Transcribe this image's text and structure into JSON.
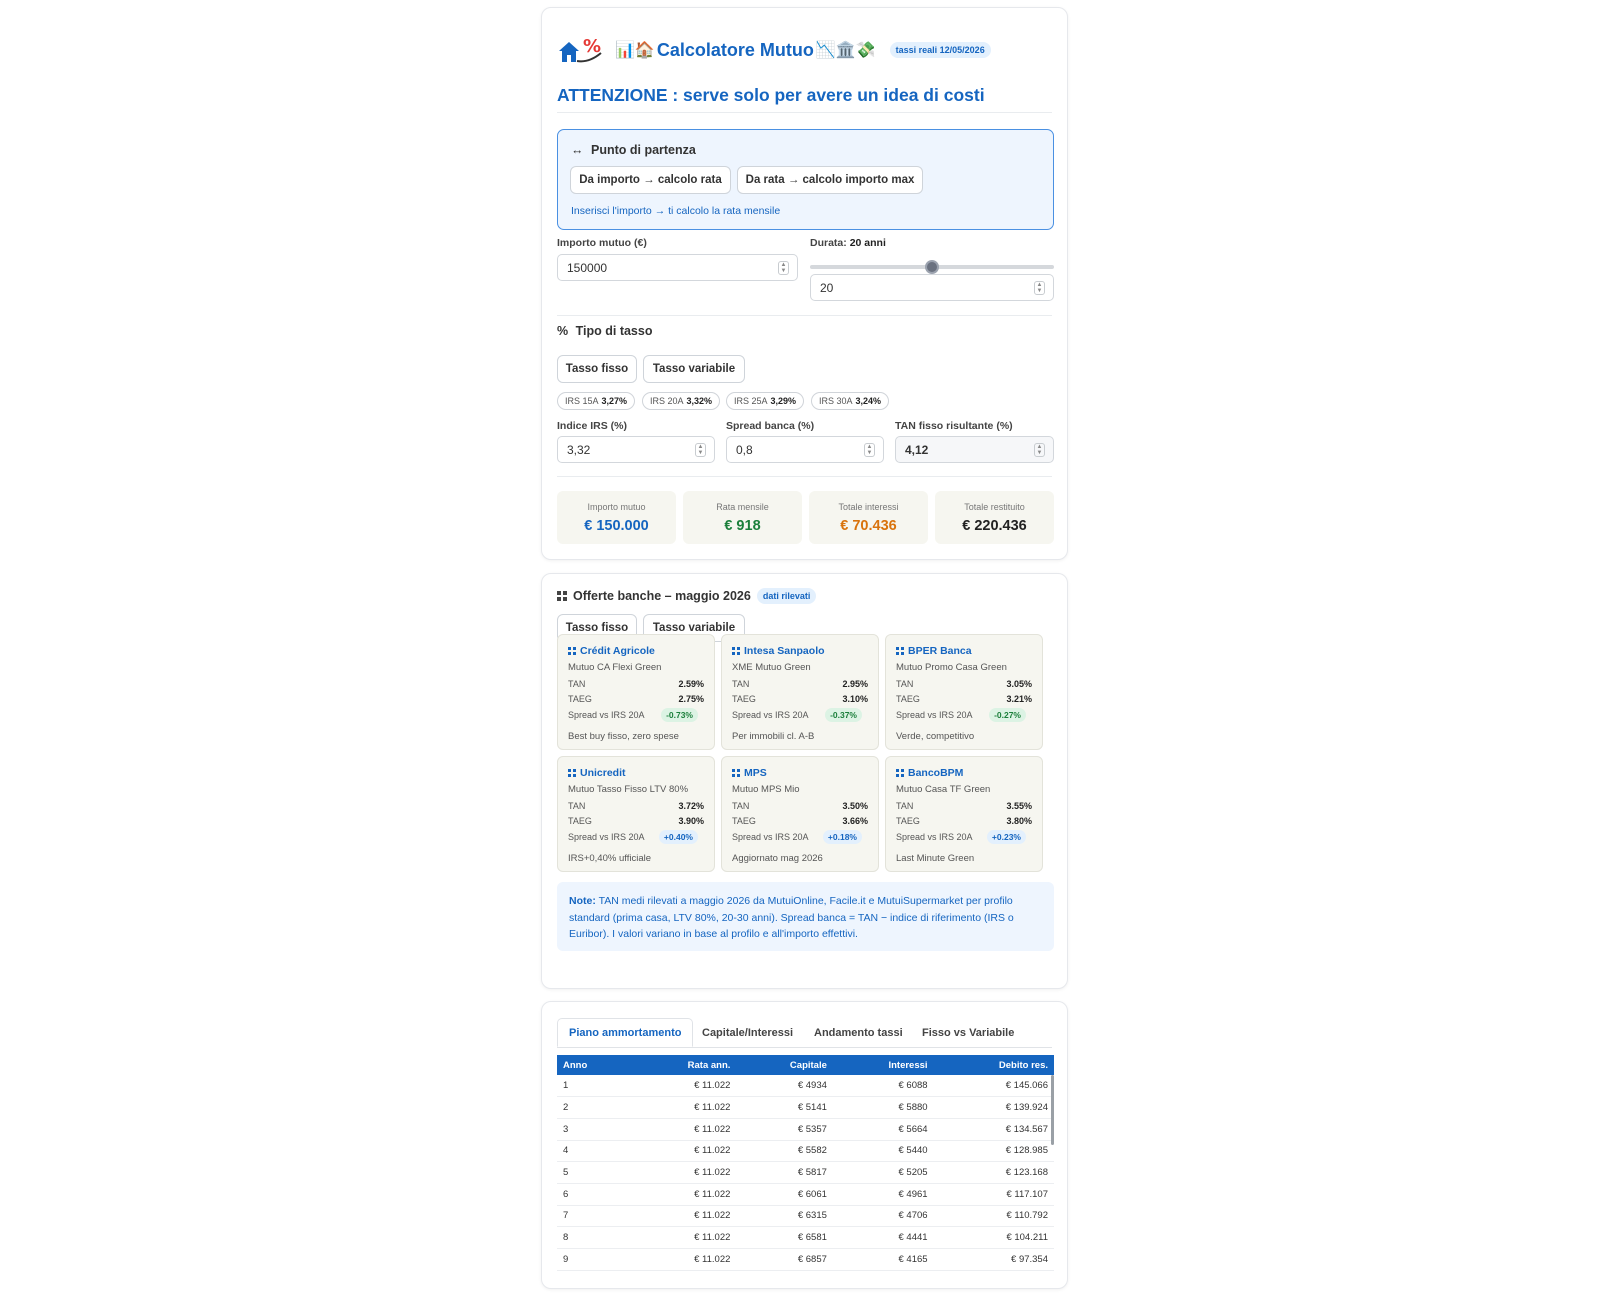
{
  "header": {
    "title_prefix_emoji": "📊🏠",
    "title": "Calcolatore Mutuo",
    "title_suffix_emoji": "📉🏛️💸",
    "rates_badge": "tassi reali 12/05/2026",
    "warning": "ATTENZIONE : serve solo per avere un idea di costi"
  },
  "start": {
    "icon": "↔",
    "title": "Punto di partenza",
    "btn_amount": "Da importo → calcolo rata",
    "btn_rate": "Da rata → calcolo importo max",
    "hint": "Inserisci l'importo → ti calcolo la rata mensile"
  },
  "amount": {
    "label": "Importo mutuo (€)",
    "value": "150000"
  },
  "duration": {
    "label": "Durata:",
    "label_value": "20 anni",
    "value": "20",
    "slider_fraction": 0.5
  },
  "rate_type": {
    "icon": "%",
    "title": "Tipo di tasso",
    "tab_fixed": "Tasso fisso",
    "tab_variable": "Tasso variabile",
    "chips": [
      {
        "label": "IRS 15A",
        "value": "3,27%"
      },
      {
        "label": "IRS 20A",
        "value": "3,32%"
      },
      {
        "label": "IRS 25A",
        "value": "3,29%"
      },
      {
        "label": "IRS 30A",
        "value": "3,24%"
      }
    ],
    "irs_label": "Indice IRS (%)",
    "irs_value": "3,32",
    "spread_label": "Spread banca (%)",
    "spread_value": "0,8",
    "tan_label": "TAN fisso risultante (%)",
    "tan_value": "4,12"
  },
  "summary": [
    {
      "label": "Importo mutuo",
      "value": "€ 150.000",
      "color": "#1565c0"
    },
    {
      "label": "Rata mensile",
      "value": "€ 918",
      "color": "#1b7f3b"
    },
    {
      "label": "Totale interessi",
      "value": "€ 70.436",
      "color": "#d9730d"
    },
    {
      "label": "Totale restituito",
      "value": "€ 220.436",
      "color": "#222222"
    }
  ],
  "offers": {
    "title": "Offerte banche – maggio 2026",
    "badge": "dati rilevati",
    "tab_fixed": "Tasso fisso",
    "tab_variable": "Tasso variabile",
    "tan_label": "TAN",
    "taeg_label": "TAEG",
    "spread_label": "Spread vs IRS 20A",
    "banks": [
      {
        "name": "Crédit Agricole",
        "product": "Mutuo CA Flexi Green",
        "tan": "2.59%",
        "taeg": "2.75%",
        "spread": "-0.73%",
        "sign": "neg",
        "note": "Best buy fisso, zero spese"
      },
      {
        "name": "Intesa Sanpaolo",
        "product": "XME Mutuo Green",
        "tan": "2.95%",
        "taeg": "3.10%",
        "spread": "-0.37%",
        "sign": "neg",
        "note": "Per immobili cl. A-B"
      },
      {
        "name": "BPER Banca",
        "product": "Mutuo Promo Casa Green",
        "tan": "3.05%",
        "taeg": "3.21%",
        "spread": "-0.27%",
        "sign": "neg",
        "note": "Verde, competitivo"
      },
      {
        "name": "Unicredit",
        "product": "Mutuo Tasso Fisso LTV 80%",
        "tan": "3.72%",
        "taeg": "3.90%",
        "spread": "+0.40%",
        "sign": "pos",
        "note": "IRS+0,40% ufficiale"
      },
      {
        "name": "MPS",
        "product": "Mutuo MPS Mio",
        "tan": "3.50%",
        "taeg": "3.66%",
        "spread": "+0.18%",
        "sign": "pos",
        "note": "Aggiornato mag 2026"
      },
      {
        "name": "BancoBPM",
        "product": "Mutuo Casa TF Green",
        "tan": "3.55%",
        "taeg": "3.80%",
        "spread": "+0.23%",
        "sign": "pos",
        "note": "Last Minute Green"
      }
    ],
    "note_label": "Note:",
    "note_text": "TAN medi rilevati a maggio 2026 da MutuiOnline, Facile.it e MutuiSupermarket per profilo standard (prima casa, LTV 80%, 20-30 anni). Spread banca = TAN − indice di riferimento (IRS o Euribor). I valori variano in base al profilo e all'importo effettivi."
  },
  "plan": {
    "tabs": [
      "Piano ammortamento",
      "Capitale/Interessi",
      "Andamento tassi",
      "Fisso vs Variabile"
    ],
    "columns": [
      "Anno",
      "Rata ann.",
      "Capitale",
      "Interessi",
      "Debito res."
    ],
    "rows": [
      [
        "1",
        "€ 11.022",
        "€ 4934",
        "€ 6088",
        "€ 145.066"
      ],
      [
        "2",
        "€ 11.022",
        "€ 5141",
        "€ 5880",
        "€ 139.924"
      ],
      [
        "3",
        "€ 11.022",
        "€ 5357",
        "€ 5664",
        "€ 134.567"
      ],
      [
        "4",
        "€ 11.022",
        "€ 5582",
        "€ 5440",
        "€ 128.985"
      ],
      [
        "5",
        "€ 11.022",
        "€ 5817",
        "€ 5205",
        "€ 123.168"
      ],
      [
        "6",
        "€ 11.022",
        "€ 6061",
        "€ 4961",
        "€ 117.107"
      ],
      [
        "7",
        "€ 11.022",
        "€ 6315",
        "€ 4706",
        "€ 110.792"
      ],
      [
        "8",
        "€ 11.022",
        "€ 6581",
        "€ 4441",
        "€ 104.211"
      ],
      [
        "9",
        "€ 11.022",
        "€ 6857",
        "€ 4165",
        "€ 97.354"
      ]
    ]
  }
}
